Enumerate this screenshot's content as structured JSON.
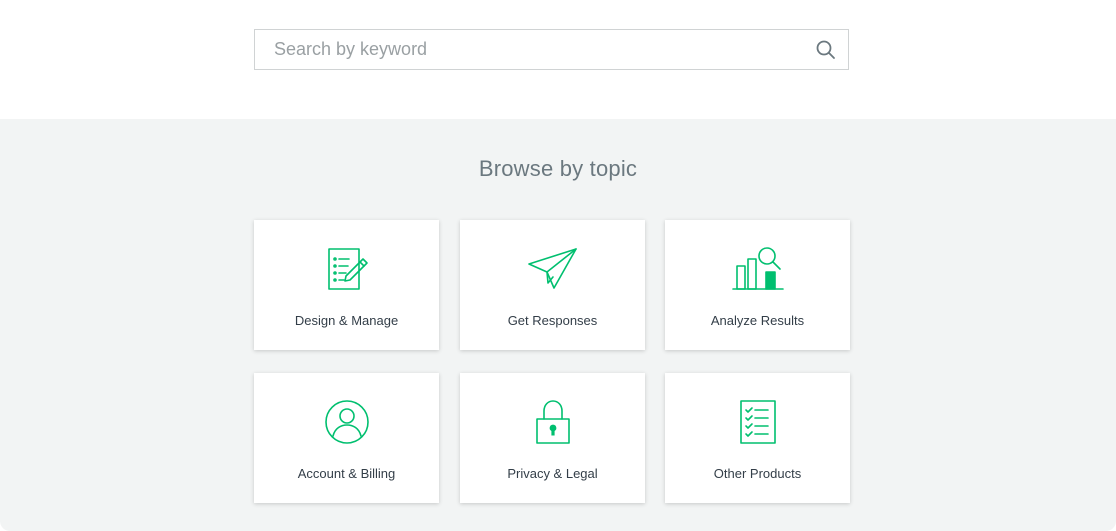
{
  "search": {
    "placeholder": "Search by keyword",
    "value": ""
  },
  "browse": {
    "title": "Browse by topic",
    "accent_color": "#00bf6f",
    "tiles": [
      {
        "label": "Design & Manage",
        "icon": "survey-edit-icon"
      },
      {
        "label": "Get Responses",
        "icon": "paper-plane-icon"
      },
      {
        "label": "Analyze Results",
        "icon": "bar-chart-magnifier-icon"
      },
      {
        "label": "Account & Billing",
        "icon": "user-account-icon"
      },
      {
        "label": "Privacy & Legal",
        "icon": "padlock-icon"
      },
      {
        "label": "Other Products",
        "icon": "checklist-icon"
      }
    ]
  }
}
